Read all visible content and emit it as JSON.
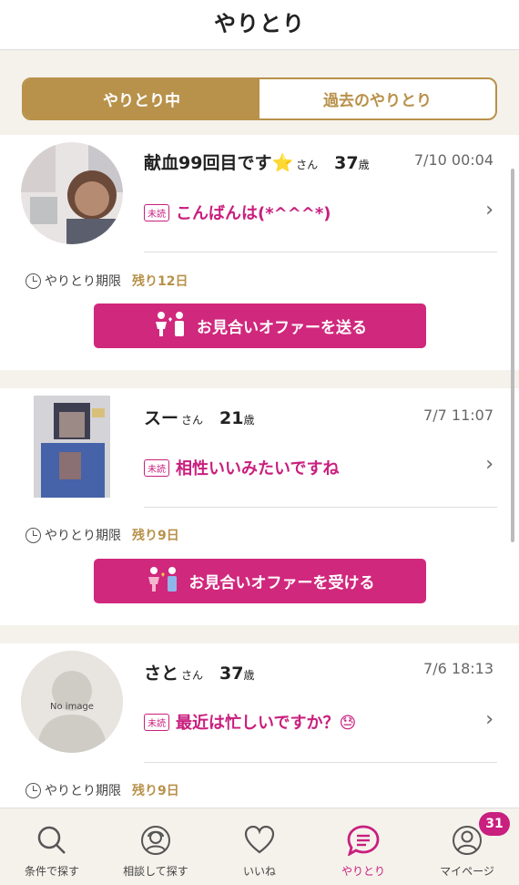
{
  "header": {
    "title": "やりとり"
  },
  "tabs": [
    {
      "label": "やりとり中",
      "active": true
    },
    {
      "label": "過去のやりとり",
      "active": false
    }
  ],
  "conversations": [
    {
      "name": "献血99回目です⭐",
      "honorific": "さん",
      "age": "37",
      "age_unit": "歳",
      "time": "7/10 00:04",
      "unread_badge": "未読",
      "message": "こんばんは(*^^^*)",
      "deadline_label": "やりとり期限",
      "deadline_remaining": "残り12日",
      "offer_button": "お見合いオファーを送る"
    },
    {
      "name": "スー",
      "honorific": "さん",
      "age": "21",
      "age_unit": "歳",
      "time": "7/7 11:07",
      "unread_badge": "未読",
      "message": "相性いいみたいですね",
      "deadline_label": "やりとり期限",
      "deadline_remaining": "残り9日",
      "offer_button": "お見合いオファーを受ける"
    },
    {
      "name": "さと",
      "honorific": "さん",
      "age": "37",
      "age_unit": "歳",
      "time": "7/6 18:13",
      "unread_badge": "未読",
      "message": "最近は忙しいですか？😓",
      "no_image_text": "No image",
      "deadline_label": "やりとり期限",
      "deadline_remaining": "残り9日"
    }
  ],
  "bottom_nav": [
    {
      "label": "条件で探す",
      "icon": "search-icon"
    },
    {
      "label": "相談して探す",
      "icon": "consultant-icon"
    },
    {
      "label": "いいね",
      "icon": "heart-icon"
    },
    {
      "label": "やりとり",
      "icon": "chat-icon",
      "active": true
    },
    {
      "label": "マイページ",
      "icon": "person-icon",
      "badge": "31"
    }
  ],
  "colors": {
    "accent_gold": "#b8914a",
    "accent_pink": "#c91f7e"
  }
}
